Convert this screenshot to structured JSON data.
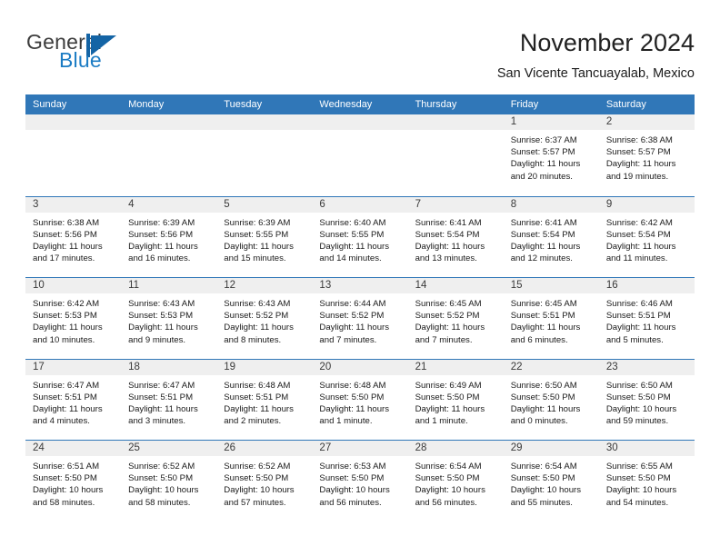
{
  "brand": {
    "name_part1": "General",
    "name_part2": "Blue",
    "logo_icon": "sail-triangle-icon",
    "accent_color": "#1464a5"
  },
  "header": {
    "title": "November 2024",
    "subtitle": "San Vicente Tancuayalab, Mexico"
  },
  "colors": {
    "header_bar": "#3077b8",
    "day_band": "#efefef",
    "row_divider": "#3077b8",
    "text": "#1a1a1a"
  },
  "weekdays": [
    "Sunday",
    "Monday",
    "Tuesday",
    "Wednesday",
    "Thursday",
    "Friday",
    "Saturday"
  ],
  "weeks": [
    [
      {
        "day": "",
        "sunrise": "",
        "sunset": "",
        "daylight": "",
        "daylight2": ""
      },
      {
        "day": "",
        "sunrise": "",
        "sunset": "",
        "daylight": "",
        "daylight2": ""
      },
      {
        "day": "",
        "sunrise": "",
        "sunset": "",
        "daylight": "",
        "daylight2": ""
      },
      {
        "day": "",
        "sunrise": "",
        "sunset": "",
        "daylight": "",
        "daylight2": ""
      },
      {
        "day": "",
        "sunrise": "",
        "sunset": "",
        "daylight": "",
        "daylight2": ""
      },
      {
        "day": "1",
        "sunrise": "Sunrise: 6:37 AM",
        "sunset": "Sunset: 5:57 PM",
        "daylight": "Daylight: 11 hours",
        "daylight2": "and 20 minutes."
      },
      {
        "day": "2",
        "sunrise": "Sunrise: 6:38 AM",
        "sunset": "Sunset: 5:57 PM",
        "daylight": "Daylight: 11 hours",
        "daylight2": "and 19 minutes."
      }
    ],
    [
      {
        "day": "3",
        "sunrise": "Sunrise: 6:38 AM",
        "sunset": "Sunset: 5:56 PM",
        "daylight": "Daylight: 11 hours",
        "daylight2": "and 17 minutes."
      },
      {
        "day": "4",
        "sunrise": "Sunrise: 6:39 AM",
        "sunset": "Sunset: 5:56 PM",
        "daylight": "Daylight: 11 hours",
        "daylight2": "and 16 minutes."
      },
      {
        "day": "5",
        "sunrise": "Sunrise: 6:39 AM",
        "sunset": "Sunset: 5:55 PM",
        "daylight": "Daylight: 11 hours",
        "daylight2": "and 15 minutes."
      },
      {
        "day": "6",
        "sunrise": "Sunrise: 6:40 AM",
        "sunset": "Sunset: 5:55 PM",
        "daylight": "Daylight: 11 hours",
        "daylight2": "and 14 minutes."
      },
      {
        "day": "7",
        "sunrise": "Sunrise: 6:41 AM",
        "sunset": "Sunset: 5:54 PM",
        "daylight": "Daylight: 11 hours",
        "daylight2": "and 13 minutes."
      },
      {
        "day": "8",
        "sunrise": "Sunrise: 6:41 AM",
        "sunset": "Sunset: 5:54 PM",
        "daylight": "Daylight: 11 hours",
        "daylight2": "and 12 minutes."
      },
      {
        "day": "9",
        "sunrise": "Sunrise: 6:42 AM",
        "sunset": "Sunset: 5:54 PM",
        "daylight": "Daylight: 11 hours",
        "daylight2": "and 11 minutes."
      }
    ],
    [
      {
        "day": "10",
        "sunrise": "Sunrise: 6:42 AM",
        "sunset": "Sunset: 5:53 PM",
        "daylight": "Daylight: 11 hours",
        "daylight2": "and 10 minutes."
      },
      {
        "day": "11",
        "sunrise": "Sunrise: 6:43 AM",
        "sunset": "Sunset: 5:53 PM",
        "daylight": "Daylight: 11 hours",
        "daylight2": "and 9 minutes."
      },
      {
        "day": "12",
        "sunrise": "Sunrise: 6:43 AM",
        "sunset": "Sunset: 5:52 PM",
        "daylight": "Daylight: 11 hours",
        "daylight2": "and 8 minutes."
      },
      {
        "day": "13",
        "sunrise": "Sunrise: 6:44 AM",
        "sunset": "Sunset: 5:52 PM",
        "daylight": "Daylight: 11 hours",
        "daylight2": "and 7 minutes."
      },
      {
        "day": "14",
        "sunrise": "Sunrise: 6:45 AM",
        "sunset": "Sunset: 5:52 PM",
        "daylight": "Daylight: 11 hours",
        "daylight2": "and 7 minutes."
      },
      {
        "day": "15",
        "sunrise": "Sunrise: 6:45 AM",
        "sunset": "Sunset: 5:51 PM",
        "daylight": "Daylight: 11 hours",
        "daylight2": "and 6 minutes."
      },
      {
        "day": "16",
        "sunrise": "Sunrise: 6:46 AM",
        "sunset": "Sunset: 5:51 PM",
        "daylight": "Daylight: 11 hours",
        "daylight2": "and 5 minutes."
      }
    ],
    [
      {
        "day": "17",
        "sunrise": "Sunrise: 6:47 AM",
        "sunset": "Sunset: 5:51 PM",
        "daylight": "Daylight: 11 hours",
        "daylight2": "and 4 minutes."
      },
      {
        "day": "18",
        "sunrise": "Sunrise: 6:47 AM",
        "sunset": "Sunset: 5:51 PM",
        "daylight": "Daylight: 11 hours",
        "daylight2": "and 3 minutes."
      },
      {
        "day": "19",
        "sunrise": "Sunrise: 6:48 AM",
        "sunset": "Sunset: 5:51 PM",
        "daylight": "Daylight: 11 hours",
        "daylight2": "and 2 minutes."
      },
      {
        "day": "20",
        "sunrise": "Sunrise: 6:48 AM",
        "sunset": "Sunset: 5:50 PM",
        "daylight": "Daylight: 11 hours",
        "daylight2": "and 1 minute."
      },
      {
        "day": "21",
        "sunrise": "Sunrise: 6:49 AM",
        "sunset": "Sunset: 5:50 PM",
        "daylight": "Daylight: 11 hours",
        "daylight2": "and 1 minute."
      },
      {
        "day": "22",
        "sunrise": "Sunrise: 6:50 AM",
        "sunset": "Sunset: 5:50 PM",
        "daylight": "Daylight: 11 hours",
        "daylight2": "and 0 minutes."
      },
      {
        "day": "23",
        "sunrise": "Sunrise: 6:50 AM",
        "sunset": "Sunset: 5:50 PM",
        "daylight": "Daylight: 10 hours",
        "daylight2": "and 59 minutes."
      }
    ],
    [
      {
        "day": "24",
        "sunrise": "Sunrise: 6:51 AM",
        "sunset": "Sunset: 5:50 PM",
        "daylight": "Daylight: 10 hours",
        "daylight2": "and 58 minutes."
      },
      {
        "day": "25",
        "sunrise": "Sunrise: 6:52 AM",
        "sunset": "Sunset: 5:50 PM",
        "daylight": "Daylight: 10 hours",
        "daylight2": "and 58 minutes."
      },
      {
        "day": "26",
        "sunrise": "Sunrise: 6:52 AM",
        "sunset": "Sunset: 5:50 PM",
        "daylight": "Daylight: 10 hours",
        "daylight2": "and 57 minutes."
      },
      {
        "day": "27",
        "sunrise": "Sunrise: 6:53 AM",
        "sunset": "Sunset: 5:50 PM",
        "daylight": "Daylight: 10 hours",
        "daylight2": "and 56 minutes."
      },
      {
        "day": "28",
        "sunrise": "Sunrise: 6:54 AM",
        "sunset": "Sunset: 5:50 PM",
        "daylight": "Daylight: 10 hours",
        "daylight2": "and 56 minutes."
      },
      {
        "day": "29",
        "sunrise": "Sunrise: 6:54 AM",
        "sunset": "Sunset: 5:50 PM",
        "daylight": "Daylight: 10 hours",
        "daylight2": "and 55 minutes."
      },
      {
        "day": "30",
        "sunrise": "Sunrise: 6:55 AM",
        "sunset": "Sunset: 5:50 PM",
        "daylight": "Daylight: 10 hours",
        "daylight2": "and 54 minutes."
      }
    ]
  ]
}
